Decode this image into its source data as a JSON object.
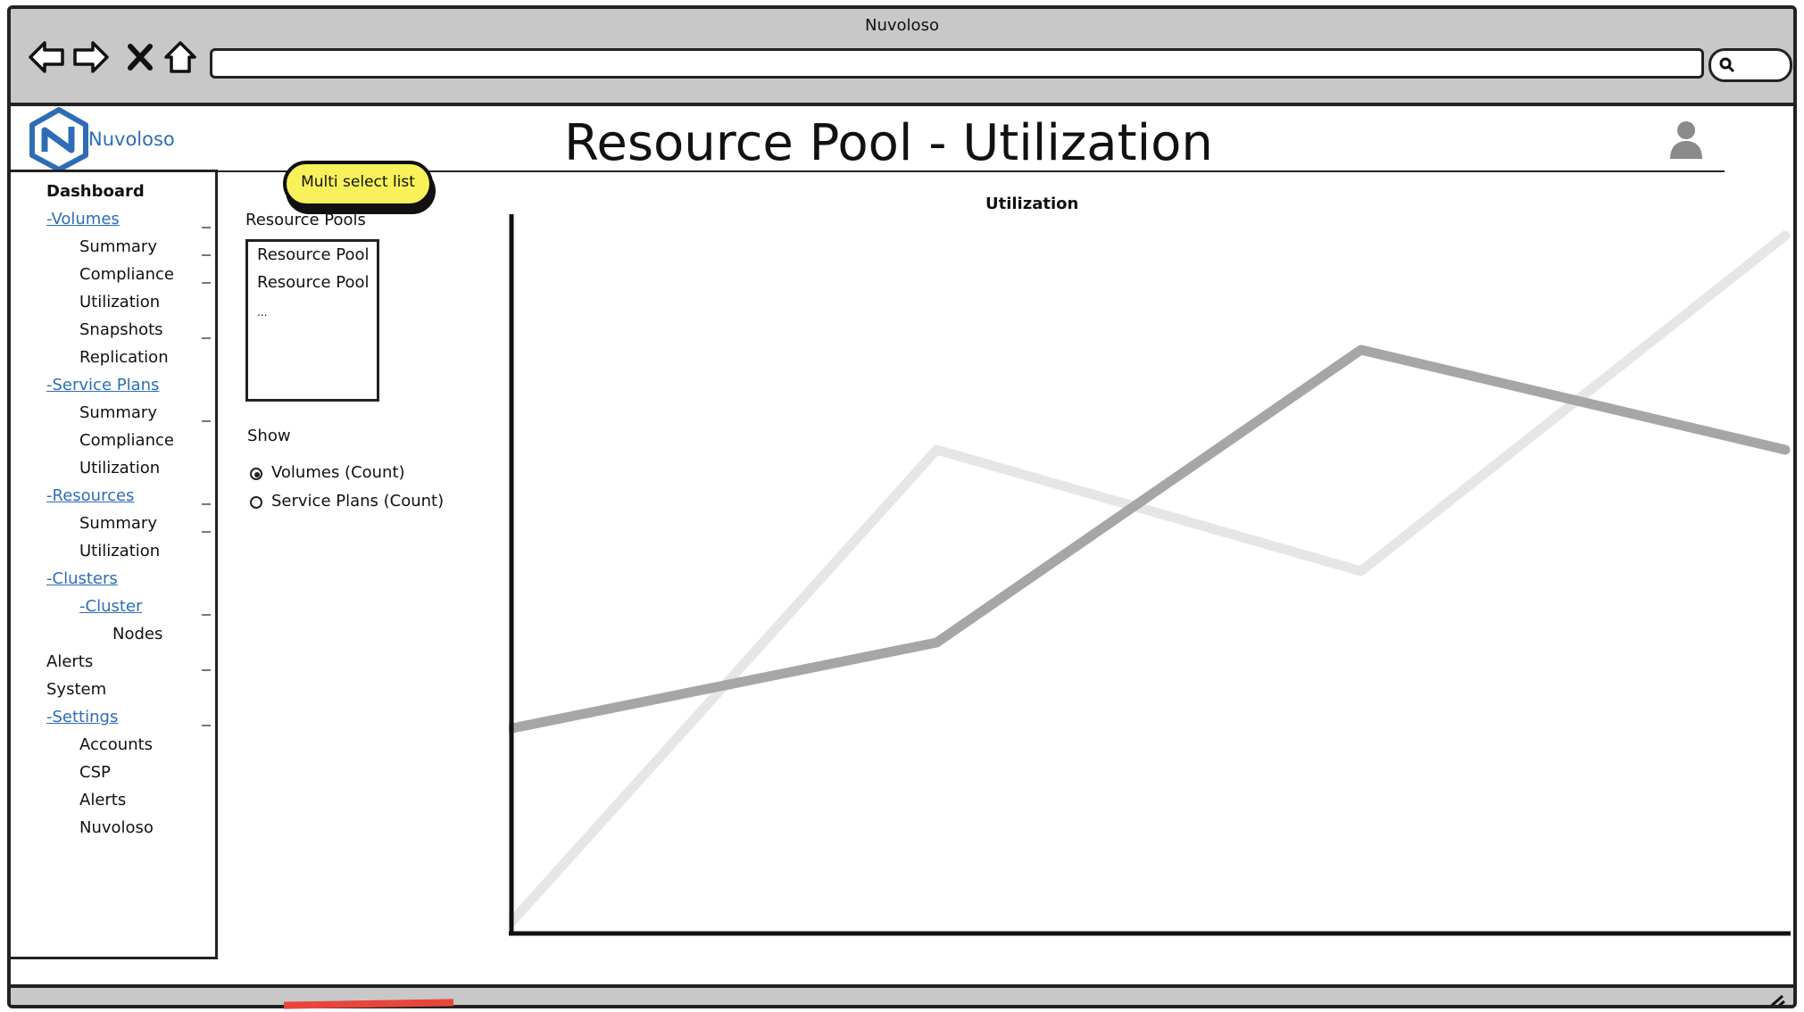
{
  "window": {
    "title": "Nuvoloso"
  },
  "brand": {
    "name": "Nuvoloso"
  },
  "page": {
    "title": "Resource Pool - Utilization"
  },
  "sidebar": {
    "items": [
      {
        "label": "Dashboard",
        "style": "bold",
        "indent": 0
      },
      {
        "label": "-Volumes",
        "style": "link",
        "indent": 0
      },
      {
        "label": "Summary",
        "style": "plain",
        "indent": 1
      },
      {
        "label": "Compliance",
        "style": "plain",
        "indent": 1
      },
      {
        "label": "Utilization",
        "style": "plain",
        "indent": 1
      },
      {
        "label": "Snapshots",
        "style": "plain",
        "indent": 1
      },
      {
        "label": "Replication",
        "style": "plain",
        "indent": 1
      },
      {
        "label": "-Service Plans",
        "style": "link",
        "indent": 0
      },
      {
        "label": "Summary",
        "style": "plain",
        "indent": 1
      },
      {
        "label": "Compliance",
        "style": "plain",
        "indent": 1
      },
      {
        "label": "Utilization",
        "style": "plain",
        "indent": 1
      },
      {
        "label": "-Resources",
        "style": "link",
        "indent": 0
      },
      {
        "label": "Summary",
        "style": "plain",
        "indent": 1
      },
      {
        "label": "Utilization",
        "style": "plain",
        "indent": 1
      },
      {
        "label": "-Clusters",
        "style": "link",
        "indent": 0
      },
      {
        "label": "-Cluster",
        "style": "link",
        "indent": 1
      },
      {
        "label": "Nodes",
        "style": "plain",
        "indent": 2
      },
      {
        "label": "Alerts",
        "style": "plain",
        "indent": 0
      },
      {
        "label": "System",
        "style": "plain",
        "indent": 0
      },
      {
        "label": "-Settings",
        "style": "link",
        "indent": 0
      },
      {
        "label": "Accounts",
        "style": "plain",
        "indent": 1
      },
      {
        "label": "CSP",
        "style": "plain",
        "indent": 1
      },
      {
        "label": "Alerts",
        "style": "plain",
        "indent": 1
      },
      {
        "label": "Nuvoloso",
        "style": "plain",
        "indent": 1
      }
    ]
  },
  "annotation": {
    "label": "Multi select list"
  },
  "filters": {
    "pools_label": "Resource Pools",
    "pools": [
      "Resource Pool",
      "Resource Pool",
      "..."
    ],
    "show_label": "Show",
    "options": [
      {
        "label": "Volumes (Count)",
        "selected": true
      },
      {
        "label": "Service Plans (Count)",
        "selected": false
      }
    ]
  },
  "chart_data": {
    "type": "line",
    "title": "Utilization",
    "xlabel": "",
    "ylabel": "",
    "x": [
      0,
      1,
      2,
      3
    ],
    "xlim": [
      0,
      3
    ],
    "ylim": [
      0,
      100
    ],
    "grid": false,
    "series": [
      {
        "values": [
          28,
          40,
          81,
          67
        ],
        "color": "#a6a6a6"
      },
      {
        "values": [
          1,
          67,
          50,
          97
        ],
        "color": "#e6e6e6"
      }
    ]
  },
  "colors": {
    "link": "#2e6db5",
    "chrome": "#c8c8c8",
    "callout": "#f8f15a"
  }
}
